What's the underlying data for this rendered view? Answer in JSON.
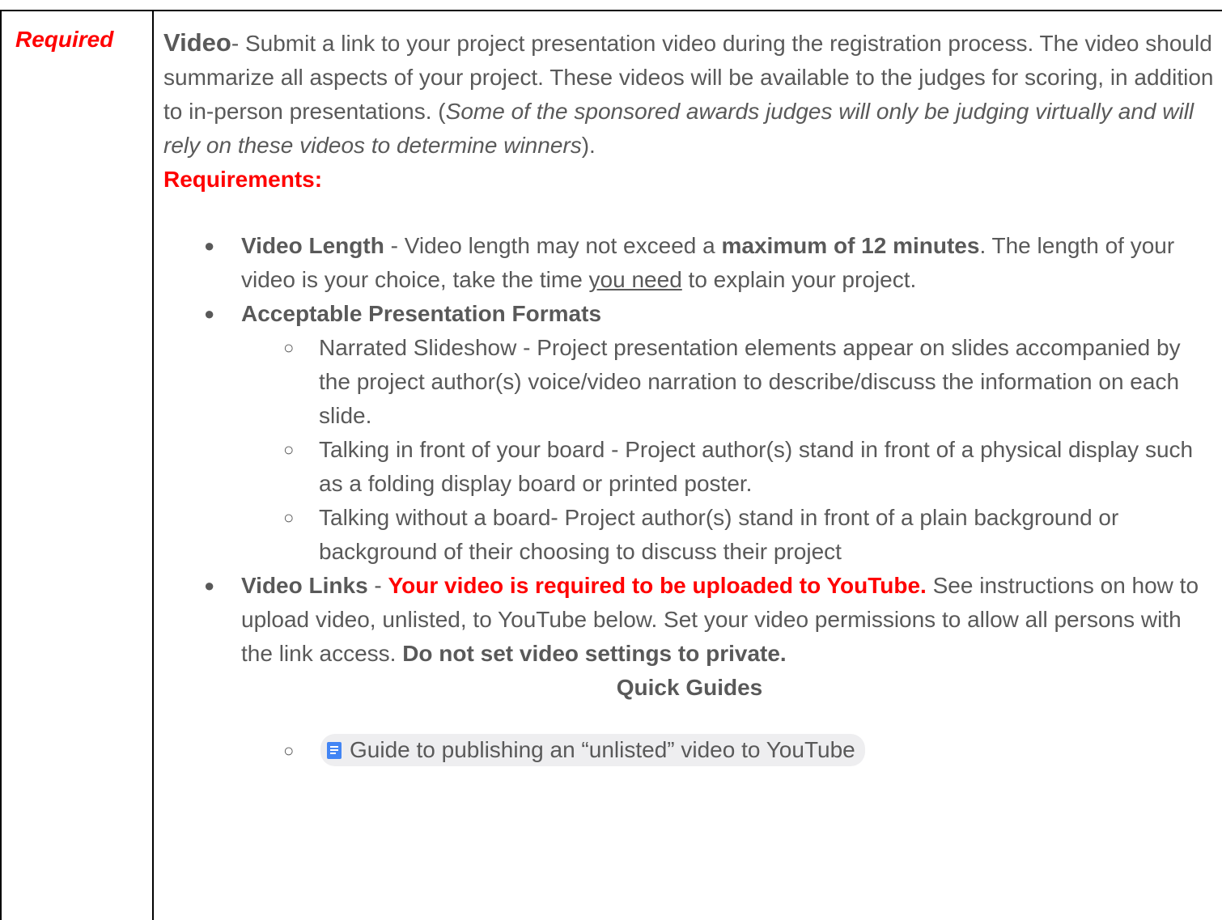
{
  "label": "Required",
  "intro": {
    "title": "Video",
    "text_1": "- Submit a link to your project presentation video during the registration process. The video should summarize all aspects of your project. These videos will be available to the judges for scoring, in addition to in-person presentations. (",
    "italic": "Some of the sponsored awards judges will only be judging virtually and will rely on these videos to determine winners",
    "text_2": ")."
  },
  "requirements_heading": "Requirements:",
  "bullets": {
    "length": {
      "label": "Video Length",
      "text_1": " -  Video length may not exceed a ",
      "bold": "maximum of 12 minutes",
      "text_2": ". The length of your video is your choice, take the time ",
      "underline": "you need",
      "text_3": " to explain your project."
    },
    "formats": {
      "label": "Acceptable Presentation Formats",
      "items": [
        "Narrated Slideshow - Project presentation elements appear on slides accompanied by the project author(s) voice/video narration to describe/discuss the information on each slide.",
        "Talking in front of your board - Project author(s) stand in front of a physical display such as a folding display board or printed poster.",
        "Talking without a board- Project author(s) stand in front of a plain background or background of their choosing to discuss their project"
      ]
    },
    "links": {
      "label": "Video Links",
      "dash": " -  ",
      "red": "Your video is required to be uploaded to YouTube.",
      "text_1": " See instructions on how to upload video, unlisted, to YouTube below. Set your video permissions to allow all persons with the link access. ",
      "bold": "Do not set video settings to private."
    }
  },
  "quick_guides": {
    "heading": "Quick Guides",
    "link_label": "Guide to publishing an “unlisted” video to YouTube",
    "link_icon": "doc-icon"
  },
  "colors": {
    "accent_red": "#ff0000",
    "body_text": "#595959",
    "doc_icon": "#4285f4"
  }
}
